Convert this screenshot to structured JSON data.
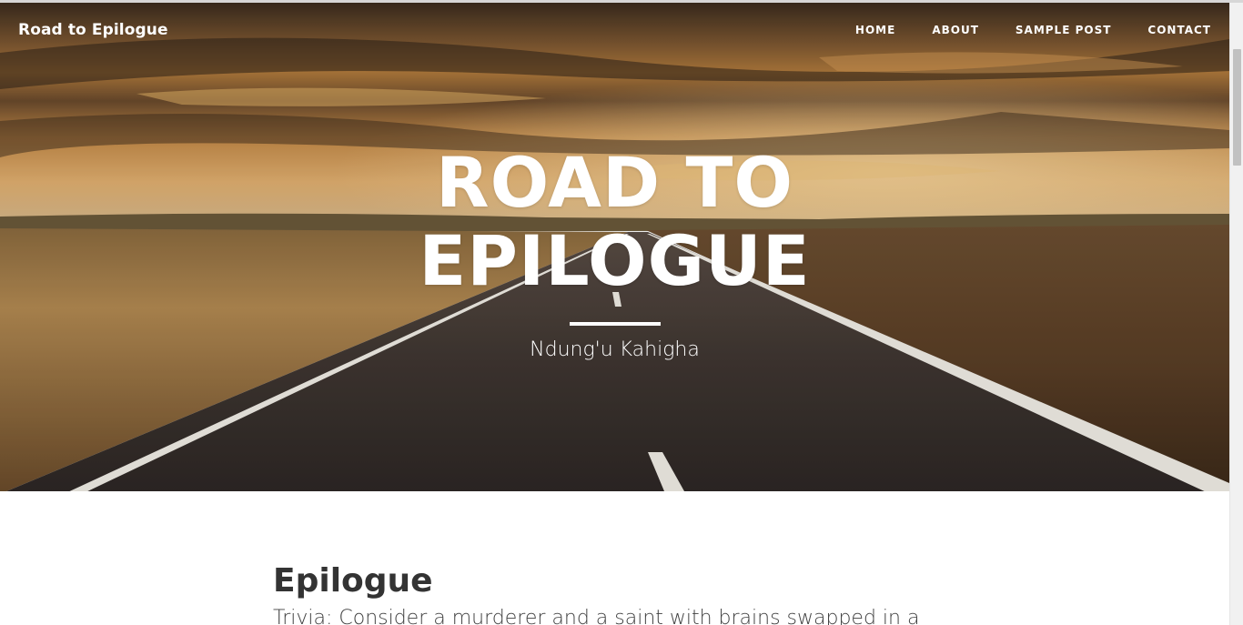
{
  "navbar": {
    "brand": "Road to Epilogue",
    "links": [
      "HOME",
      "ABOUT",
      "SAMPLE POST",
      "CONTACT"
    ]
  },
  "hero": {
    "title": "ROAD TO EPILOGUE",
    "subtitle": "Ndung'u Kahigha"
  },
  "post": {
    "title": "Epilogue",
    "excerpt": "Trivia: Consider a murderer and a saint with brains swapped in a"
  },
  "colors": {
    "sky_top": "#3e2f21",
    "sky_glow": "#e0a452",
    "field": "#a57c48",
    "road": "#3a3431",
    "heading_text": "#333333"
  }
}
